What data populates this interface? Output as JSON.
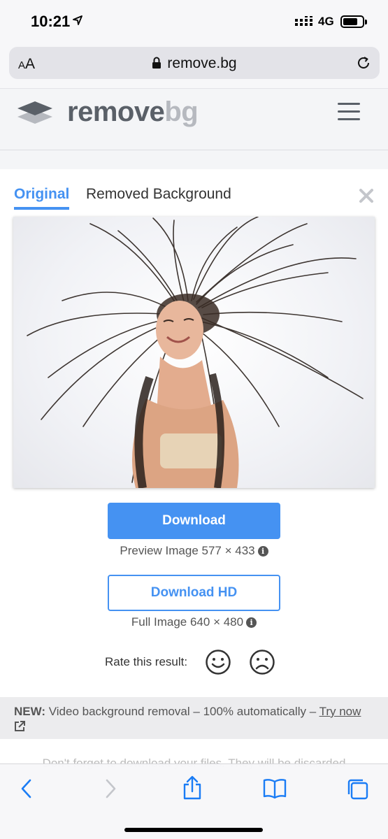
{
  "status_bar": {
    "time": "10:21",
    "network": "4G"
  },
  "browser": {
    "text_size_label_small": "A",
    "text_size_label_large": "A",
    "url": "remove.bg"
  },
  "site": {
    "logo_part1": "remove",
    "logo_part2": "bg"
  },
  "tabs": {
    "original": "Original",
    "removed": "Removed Background"
  },
  "actions": {
    "download": "Download",
    "preview_info": "Preview Image 577 × 433",
    "download_hd": "Download HD",
    "full_info": "Full Image 640 × 480",
    "rate_label": "Rate this result:"
  },
  "promo": {
    "new_label": "NEW:",
    "text": " Video background removal – 100% automatically – ",
    "link": "Try now"
  },
  "footer_note": "Don't forget to download your files. They will be discarded",
  "colors": {
    "accent": "#4592f2",
    "logo_dark": "#5a6068",
    "logo_light": "#b6b9bf",
    "ios_blue": "#1a7cf5"
  },
  "icons": [
    "location-arrow-icon",
    "signal-icon",
    "battery-icon",
    "lock-icon",
    "reload-icon",
    "logo-layers-icon",
    "hamburger-menu-icon",
    "close-icon",
    "info-icon",
    "smiley-happy-icon",
    "smiley-sad-icon",
    "external-link-icon",
    "back-icon",
    "forward-icon",
    "share-icon",
    "bookmarks-icon",
    "tabs-icon"
  ]
}
